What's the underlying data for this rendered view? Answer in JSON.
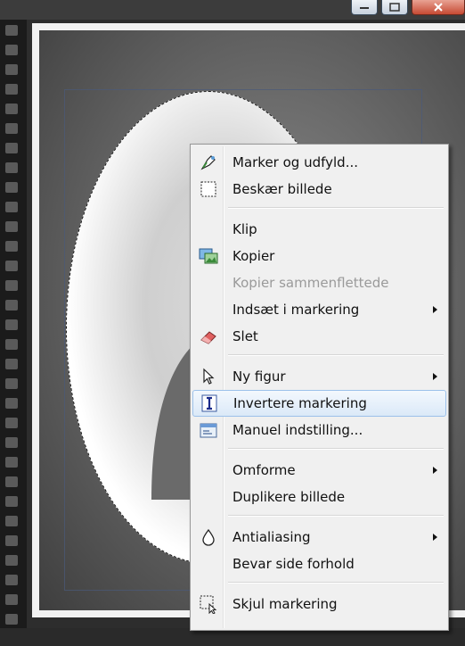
{
  "menu": {
    "items": [
      {
        "label": "Marker og udfyld...",
        "icon": "marker-fill-icon",
        "disabled": false,
        "submenu": false
      },
      {
        "label": "Beskær billede",
        "icon": "crop-icon",
        "disabled": false,
        "submenu": false
      },
      {
        "label": "Klip",
        "icon": "",
        "disabled": false,
        "submenu": false
      },
      {
        "label": "Kopier",
        "icon": "copy-image-icon",
        "disabled": false,
        "submenu": false
      },
      {
        "label": "Kopier sammenflettede",
        "icon": "",
        "disabled": true,
        "submenu": false
      },
      {
        "label": "Indsæt i markering",
        "icon": "",
        "disabled": false,
        "submenu": true
      },
      {
        "label": "Slet",
        "icon": "eraser-icon",
        "disabled": false,
        "submenu": false
      },
      {
        "label": "Ny figur",
        "icon": "pointer-shape-icon",
        "disabled": false,
        "submenu": true
      },
      {
        "label": "Invertere markering",
        "icon": "invert-selection-icon",
        "disabled": false,
        "submenu": false,
        "highlighted": true
      },
      {
        "label": "Manuel indstilling...",
        "icon": "manual-settings-icon",
        "disabled": false,
        "submenu": false
      },
      {
        "label": "Omforme",
        "icon": "",
        "disabled": false,
        "submenu": true
      },
      {
        "label": "Duplikere billede",
        "icon": "",
        "disabled": false,
        "submenu": false
      },
      {
        "label": "Antialiasing",
        "icon": "droplet-icon",
        "disabled": false,
        "submenu": true
      },
      {
        "label": "Bevar side forhold",
        "icon": "",
        "disabled": false,
        "submenu": false
      },
      {
        "label": "Skjul markering",
        "icon": "hide-selection-icon",
        "disabled": false,
        "submenu": false
      }
    ]
  },
  "colors": {
    "highlight_border": "#9cc1ea",
    "disabled_text": "#9a9a9a",
    "close_button": "#c74a33"
  }
}
